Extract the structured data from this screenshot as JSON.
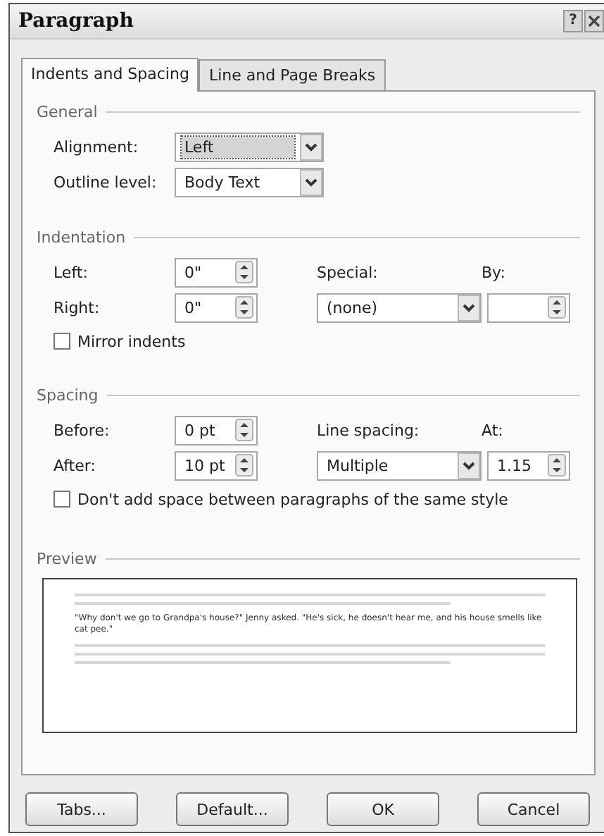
{
  "window": {
    "title": "Paragraph",
    "help": "?"
  },
  "tabs": [
    {
      "label": "Indents and Spacing",
      "selected": true
    },
    {
      "label": "Line and Page Breaks",
      "selected": false
    }
  ],
  "general": {
    "heading": "General",
    "fields": [
      {
        "kind": "dropdown",
        "label": "Alignment:",
        "value": "Left",
        "focused": true
      },
      {
        "kind": "dropdown",
        "label": "Outline level:",
        "value": "Body Text",
        "focused": false
      }
    ]
  },
  "indentation": {
    "heading": "Indentation",
    "left": {
      "kind": "spinner",
      "label": "Left:",
      "value": "0\""
    },
    "right": {
      "kind": "spinner",
      "label": "Right:",
      "value": "0\""
    },
    "special": {
      "kind": "dropdown",
      "label": "Special:",
      "value": "(none)",
      "focused": false
    },
    "by": {
      "kind": "spinner",
      "label": "By:"
    },
    "mirror": {
      "label": "Mirror indents",
      "checked": false
    }
  },
  "spacing": {
    "heading": "Spacing",
    "before": {
      "kind": "spinner",
      "label": "Before:",
      "value": "0 pt"
    },
    "after": {
      "kind": "spinner",
      "label": "After:",
      "value": "10 pt"
    },
    "line_spacing": {
      "kind": "dropdown",
      "label": "Line spacing:",
      "value": "Multiple",
      "focused": false
    },
    "at": {
      "kind": "spinner",
      "label": "At:",
      "value": "1.15"
    },
    "same_style": {
      "label": "Don't add space between paragraphs of the same style",
      "checked": false
    }
  },
  "preview": {
    "heading": "Preview",
    "sample": "\"Why don't we go to Grandpa's house?\" Jenny asked. \"He's sick, he doesn't hear me, and his house smells like cat pee.\""
  },
  "buttons": [
    {
      "label": "Tabs..."
    },
    {
      "label": "Default..."
    },
    {
      "label": "OK"
    },
    {
      "label": "Cancel"
    }
  ]
}
